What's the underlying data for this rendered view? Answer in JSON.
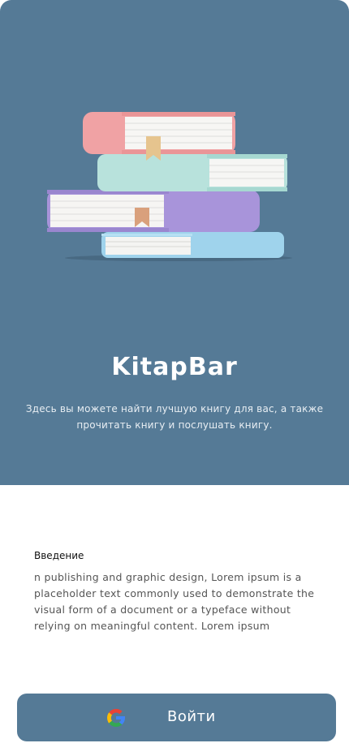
{
  "hero": {
    "illustration": "stacked-books-illustration",
    "app_title": "KitapBar",
    "tagline": "Здесь вы можете найти лучшую книгу для вас, а также прочитать книгу и послушать книгу."
  },
  "intro": {
    "heading": "Введение",
    "text": "n publishing and graphic design, Lorem ipsum is a placeholder text commonly used to demonstrate the visual form of a document or a typeface without relying on meaningful content. Lorem ipsum"
  },
  "login": {
    "label": "Войти",
    "icon": "google-icon"
  },
  "colors": {
    "primary": "#557a96",
    "background": "#ffffff"
  }
}
